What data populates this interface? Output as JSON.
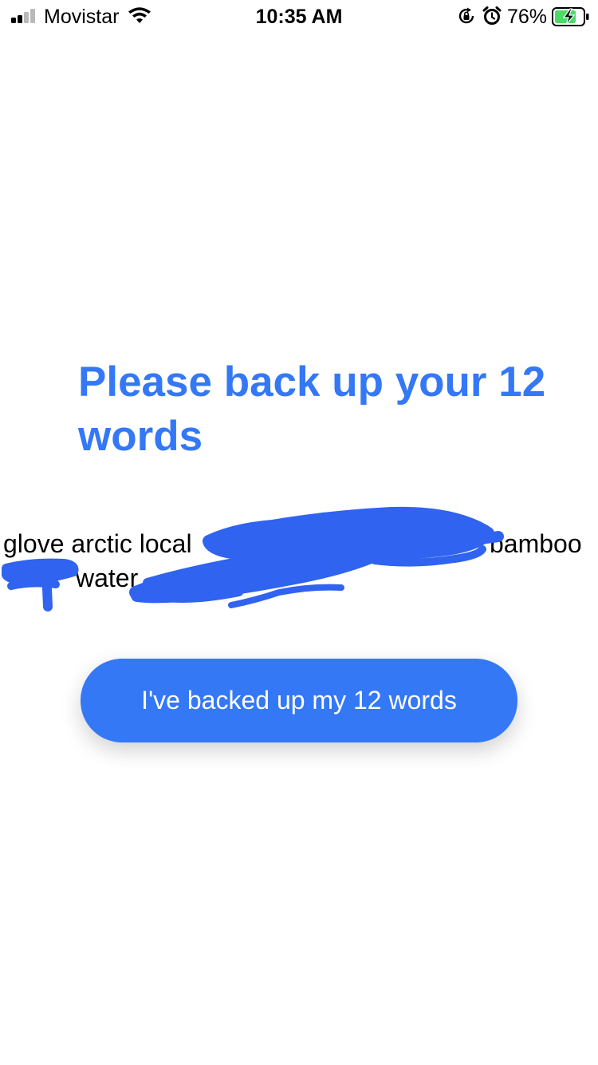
{
  "status_bar": {
    "carrier": "Movistar",
    "time": "10:35 AM",
    "battery_percent": "76%",
    "icons": [
      "signal-icon",
      "wifi-icon",
      "orientation-lock-icon",
      "alarm-icon",
      "battery-charging-icon"
    ]
  },
  "screen": {
    "title": "Please back up your 12 words",
    "seed_words_visible": {
      "line1_left": "glove arctic local",
      "line1_right": "bamboo",
      "line2": "water"
    },
    "button_label": "I've backed up my 12 words"
  },
  "colors": {
    "accent": "#3478f6",
    "redaction": "#2f63f0",
    "background": "#ffffff"
  }
}
